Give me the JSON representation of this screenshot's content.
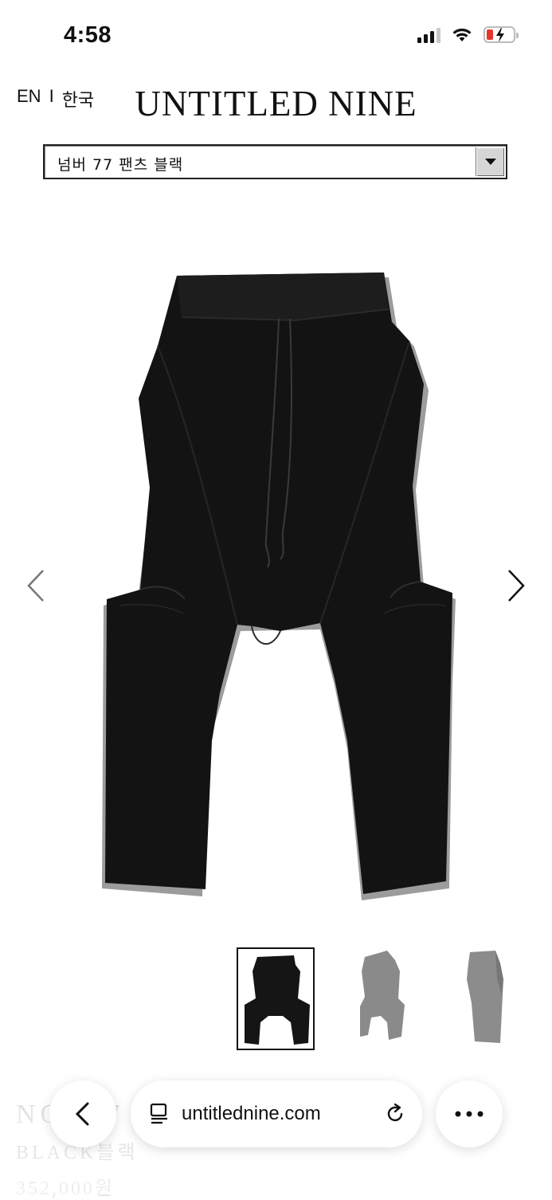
{
  "status_bar": {
    "time": "4:58"
  },
  "header": {
    "lang_en": "EN",
    "lang_sep": "I",
    "lang_ko": "한국",
    "brand": "UNTITLED NINE"
  },
  "product_select": {
    "selected": "넘버 77 팬츠 블랙"
  },
  "product": {
    "name": "NO. 77 PANTS",
    "color": "BLACK블랙",
    "price": "352,000원"
  },
  "browser": {
    "url": "untitlednine.com"
  },
  "colors": {
    "background": "#ffffff",
    "text": "#111111",
    "battery_low": "#e5352b"
  },
  "icons": [
    "signal-icon",
    "wifi-icon",
    "battery-icon",
    "dropdown-arrow-icon",
    "chevron-left-icon",
    "chevron-right-icon",
    "back-icon",
    "tabs-icon",
    "reload-icon",
    "more-icon"
  ]
}
